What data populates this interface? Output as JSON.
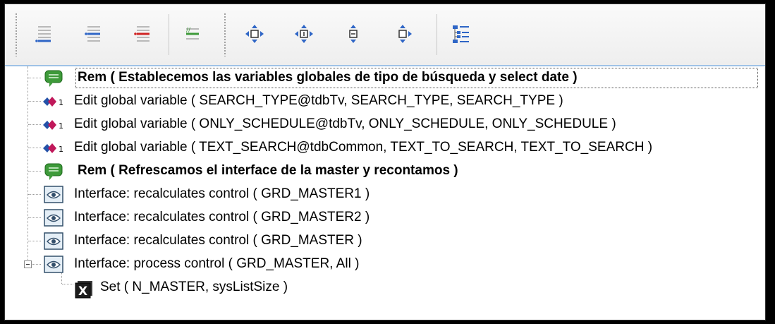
{
  "toolbar": {
    "buttons": [
      {
        "icon": "insert-line-icon"
      },
      {
        "icon": "add-line-icon"
      },
      {
        "icon": "remove-line-icon"
      },
      {
        "icon": "comment-line-icon"
      },
      {
        "icon": "move-all-icon"
      },
      {
        "icon": "move-left-right-icon"
      },
      {
        "icon": "move-up-icon"
      },
      {
        "icon": "move-down-icon"
      },
      {
        "icon": "tree-view-icon"
      }
    ]
  },
  "tree": {
    "rows": [
      {
        "label": "Rem ( Establecemos las variables globales de tipo de búsqueda y select date )",
        "icon": "comment-bubble-icon",
        "bold": true,
        "selected": true
      },
      {
        "label": "Edit global variable ( SEARCH_TYPE@tdbTv, SEARCH_TYPE, SEARCH_TYPE )",
        "icon": "global-variable-icon",
        "bold": false
      },
      {
        "label": "Edit global variable ( ONLY_SCHEDULE@tdbTv, ONLY_SCHEDULE, ONLY_SCHEDULE )",
        "icon": "global-variable-icon",
        "bold": false
      },
      {
        "label": "Edit global variable ( TEXT_SEARCH@tdbCommon, TEXT_TO_SEARCH, TEXT_TO_SEARCH )",
        "icon": "global-variable-icon",
        "bold": false
      },
      {
        "label": "Rem ( Refrescamos el interface de la master y recontamos )",
        "icon": "comment-bubble-icon",
        "bold": true
      },
      {
        "label": "Interface: recalculates control ( GRD_MASTER1 )",
        "icon": "interface-eye-icon",
        "bold": false
      },
      {
        "label": "Interface: recalculates control ( GRD_MASTER2 )",
        "icon": "interface-eye-icon",
        "bold": false
      },
      {
        "label": "Interface: recalculates control ( GRD_MASTER )",
        "icon": "interface-eye-icon",
        "bold": false
      },
      {
        "label": "Interface: process control ( GRD_MASTER, All )",
        "icon": "interface-eye-icon",
        "bold": false,
        "expanded": true
      },
      {
        "label": "Set ( N_MASTER, sysListSize )",
        "icon": "set-x-icon",
        "bold": false,
        "child": true
      }
    ]
  },
  "colors": {
    "comment_green": "#3e9a3a",
    "variable_red": "#c0185a",
    "variable_blue": "#2452a8",
    "toolbar_border": "#9fc2e6"
  }
}
